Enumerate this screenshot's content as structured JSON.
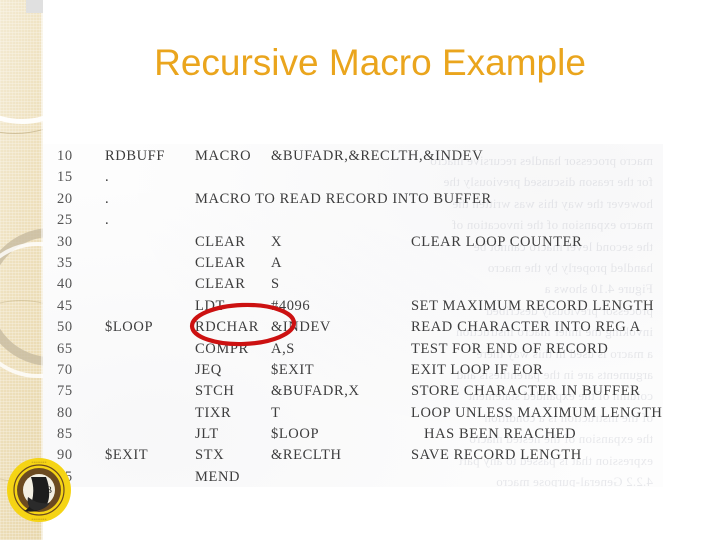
{
  "slide": {
    "title": "Recursive Macro Example",
    "title_color": "#eaa51d",
    "background_color": "#ffffff",
    "sidebar_color": "#eee0bd"
  },
  "annotation": {
    "shape": "ellipse",
    "color": "#cc1111",
    "targets_text": "RDCHAR",
    "targets_line_number": "50"
  },
  "logo": {
    "name": "university-seal",
    "outer_color": "#f5d414",
    "inner_color": "#6b4a20",
    "letter": "B"
  },
  "code_listing": {
    "columns": [
      "line",
      "label",
      "opcode",
      "operand",
      "comment"
    ],
    "rows": [
      {
        "line": "10",
        "label": "RDBUFF",
        "opcode": "MACRO",
        "operand": "&BUFADR,&RECLTH,&INDEV",
        "comment": ""
      },
      {
        "line": "15",
        "label": ".",
        "opcode": "",
        "operand": "",
        "comment": ""
      },
      {
        "line": "20",
        "label": ".",
        "opcode": "MACRO TO READ RECORD INTO BUFFER",
        "operand": "",
        "comment": ""
      },
      {
        "line": "25",
        "label": ".",
        "opcode": "",
        "operand": "",
        "comment": ""
      },
      {
        "line": "30",
        "label": "",
        "opcode": "CLEAR",
        "operand": "X",
        "comment": "CLEAR LOOP COUNTER"
      },
      {
        "line": "35",
        "label": "",
        "opcode": "CLEAR",
        "operand": "A",
        "comment": ""
      },
      {
        "line": "40",
        "label": "",
        "opcode": "CLEAR",
        "operand": "S",
        "comment": ""
      },
      {
        "line": "45",
        "label": "",
        "opcode": "LDT",
        "operand": "#4096",
        "comment": "SET MAXIMUM RECORD LENGTH"
      },
      {
        "line": "50",
        "label": "$LOOP",
        "opcode": "RDCHAR",
        "operand": "&INDEV",
        "comment": "READ CHARACTER INTO REG A"
      },
      {
        "line": "65",
        "label": "",
        "opcode": "COMPR",
        "operand": "A,S",
        "comment": "TEST FOR END OF RECORD"
      },
      {
        "line": "70",
        "label": "",
        "opcode": "JEQ",
        "operand": "$EXIT",
        "comment": "EXIT LOOP IF EOR"
      },
      {
        "line": "75",
        "label": "",
        "opcode": "STCH",
        "operand": "&BUFADR,X",
        "comment": "STORE CHARACTER IN BUFFER"
      },
      {
        "line": "80",
        "label": "",
        "opcode": "TIXR",
        "operand": "T",
        "comment": "LOOP UNLESS MAXIMUM LENGTH"
      },
      {
        "line": "85",
        "label": "",
        "opcode": "JLT",
        "operand": "$LOOP",
        "comment": "HAS BEEN REACHED",
        "comment_indent": true
      },
      {
        "line": "90",
        "label": "$EXIT",
        "opcode": "STX",
        "operand": "&RECLTH",
        "comment": "SAVE RECORD LENGTH"
      },
      {
        "line": "95",
        "label": "",
        "opcode": "MEND",
        "operand": "",
        "comment": ""
      }
    ]
  },
  "ghost_text": {
    "lines": [
      "macro processor handles recursive macro",
      "for the reason discussed previously the",
      "however the way this was written the",
      "macro expansion of the invocation of",
      "the second level macro cannot be",
      "handled properly by the macro",
      "Figure 4.10 shows a",
      "processor previously described",
      "invoking the inner macro instruction",
      "a macro is used in this way there",
      "arguments are in the parenthesis and",
      "column of the expanded statement",
      "of the instruction is a condition",
      "the expansion of the nested macro",
      "expression that is passed to any part",
      "4.2.2 General-purpose macro"
    ]
  }
}
